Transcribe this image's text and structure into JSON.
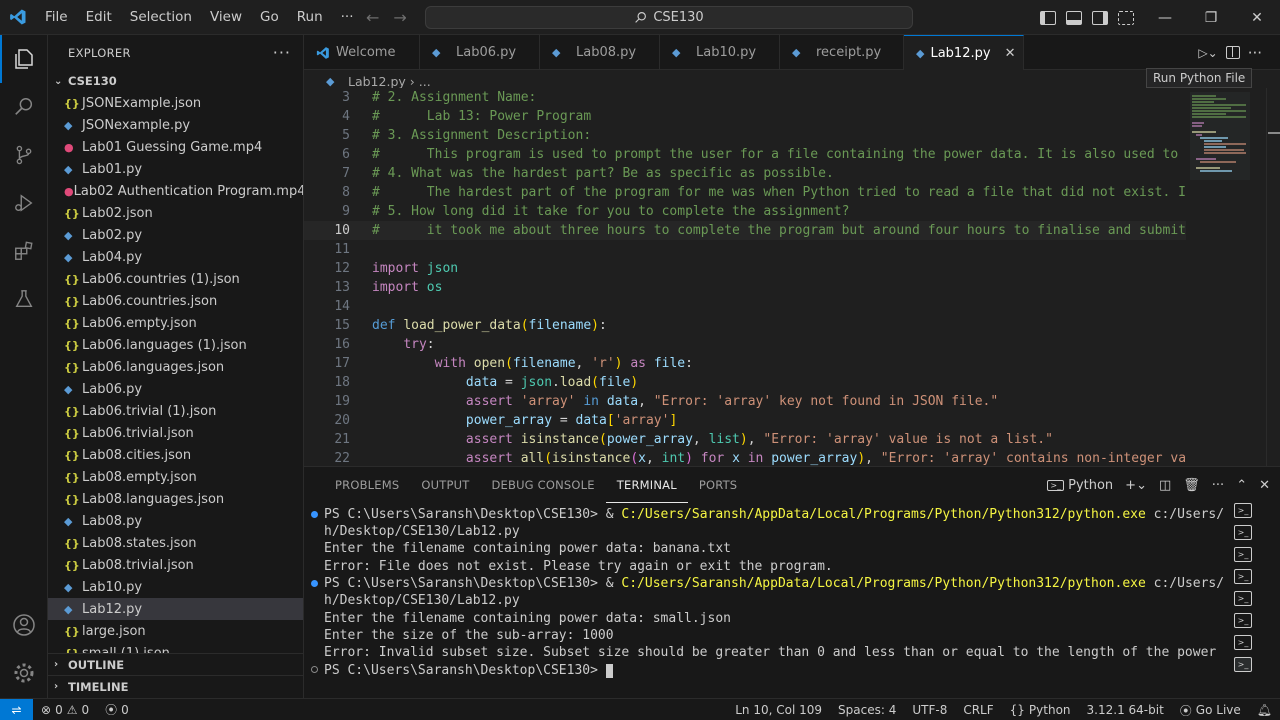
{
  "titlebar": {
    "menus": [
      "File",
      "Edit",
      "Selection",
      "View",
      "Go",
      "Run",
      "···"
    ],
    "search": "CSE130"
  },
  "sidebar": {
    "title": "EXPLORER",
    "folder": "CSE130",
    "files": [
      {
        "name": "JSONExample.json",
        "type": "json"
      },
      {
        "name": "JSONexample.py",
        "type": "py"
      },
      {
        "name": "Lab01 Guessing Game.mp4",
        "type": "mp4"
      },
      {
        "name": "Lab01.py",
        "type": "py"
      },
      {
        "name": "Lab02 Authentication Program.mp4",
        "type": "mp4"
      },
      {
        "name": "Lab02.json",
        "type": "json"
      },
      {
        "name": "Lab02.py",
        "type": "py"
      },
      {
        "name": "Lab04.py",
        "type": "py"
      },
      {
        "name": "Lab06.countries (1).json",
        "type": "json"
      },
      {
        "name": "Lab06.countries.json",
        "type": "json"
      },
      {
        "name": "Lab06.empty.json",
        "type": "json"
      },
      {
        "name": "Lab06.languages (1).json",
        "type": "json"
      },
      {
        "name": "Lab06.languages.json",
        "type": "json"
      },
      {
        "name": "Lab06.py",
        "type": "py"
      },
      {
        "name": "Lab06.trivial (1).json",
        "type": "json"
      },
      {
        "name": "Lab06.trivial.json",
        "type": "json"
      },
      {
        "name": "Lab08.cities.json",
        "type": "json"
      },
      {
        "name": "Lab08.empty.json",
        "type": "json"
      },
      {
        "name": "Lab08.languages.json",
        "type": "json"
      },
      {
        "name": "Lab08.py",
        "type": "py"
      },
      {
        "name": "Lab08.states.json",
        "type": "json"
      },
      {
        "name": "Lab08.trivial.json",
        "type": "json"
      },
      {
        "name": "Lab10.py",
        "type": "py"
      },
      {
        "name": "Lab12.py",
        "type": "py",
        "selected": true
      },
      {
        "name": "large.json",
        "type": "json"
      },
      {
        "name": "small (1).json",
        "type": "json"
      }
    ],
    "outline": "OUTLINE",
    "timeline": "TIMELINE"
  },
  "tabs": [
    {
      "label": "Welcome",
      "icon": "vscode-icon"
    },
    {
      "label": "Lab06.py",
      "icon": "python-icon"
    },
    {
      "label": "Lab08.py",
      "icon": "python-icon"
    },
    {
      "label": "Lab10.py",
      "icon": "python-icon"
    },
    {
      "label": "receipt.py",
      "icon": "python-icon"
    },
    {
      "label": "Lab12.py",
      "icon": "python-icon",
      "active": true
    }
  ],
  "tooltip": "Run Python File",
  "breadcrumb": {
    "file": "Lab12.py",
    "rest": "..."
  },
  "code": {
    "current_line": 10,
    "lines": [
      3,
      4,
      5,
      6,
      7,
      8,
      9,
      10,
      11,
      12,
      13,
      14,
      15,
      16,
      17,
      18,
      19,
      20,
      21,
      22
    ],
    "l3": "# 2. Assignment Name:",
    "l4": "#      Lab 13: Power Program",
    "l5": "# 3. Assignment Description:",
    "l6": "#      This program is used to prompt the user for a file containing the power data. It is also used to pr",
    "l7": "# 4. What was the hardest part? Be as specific as possible.",
    "l8": "#      The hardest part of the program for me was when Python tried to read a file that did not exist. I u",
    "l9": "# 5. How long did it take for you to complete the assignment?",
    "l10": "#      it took me about three hours to complete the program but around four hours to finalise and submit i",
    "s18_arr": "'array'",
    "s19_err": "\"Error: 'array' key not found in JSON file.\"",
    "s21_err": "\"Error: 'array' value is not a list.\"",
    "s22_err": "\"Error: 'array' contains non-integer valu"
  },
  "panel": {
    "tabs": [
      "PROBLEMS",
      "OUTPUT",
      "DEBUG CONSOLE",
      "TERMINAL",
      "PORTS"
    ],
    "active_tab": "TERMINAL",
    "shell": "Python",
    "terminal": {
      "prompt": "PS C:\\Users\\Saransh\\Desktop\\CSE130> ",
      "cmd_amp": "& ",
      "cmd_exe": "C:/Users/Saransh/AppData/Local/Programs/Python/Python312/python.exe",
      "cmd_arg1": " c:/Users/Sarans",
      "cmd_arg2": "h/Desktop/CSE130/Lab12.py",
      "out1": "Enter the filename containing power data: banana.txt",
      "out2": "Error: File does not exist. Please try again or exit the program.",
      "out3": "Enter the filename containing power data: small.json",
      "out4": "Enter the size of the sub-array: 1000",
      "out5": "Error: Invalid subset size. Subset size should be greater than 0 and less than or equal to the length of the power array.",
      "final_prompt": "PS C:\\Users\\Saransh\\Desktop\\CSE130> "
    }
  },
  "statusbar": {
    "errors": "0",
    "warnings": "0",
    "ports": "0",
    "position": "Ln 10, Col 109",
    "spaces": "Spaces: 4",
    "encoding": "UTF-8",
    "eol": "CRLF",
    "language": "Python",
    "interpreter": "3.12.1 64-bit",
    "golive": "Go Live"
  },
  "colors": {
    "accent": "#0078d4",
    "background": "#1f1f1f",
    "sidebar": "#181818"
  }
}
